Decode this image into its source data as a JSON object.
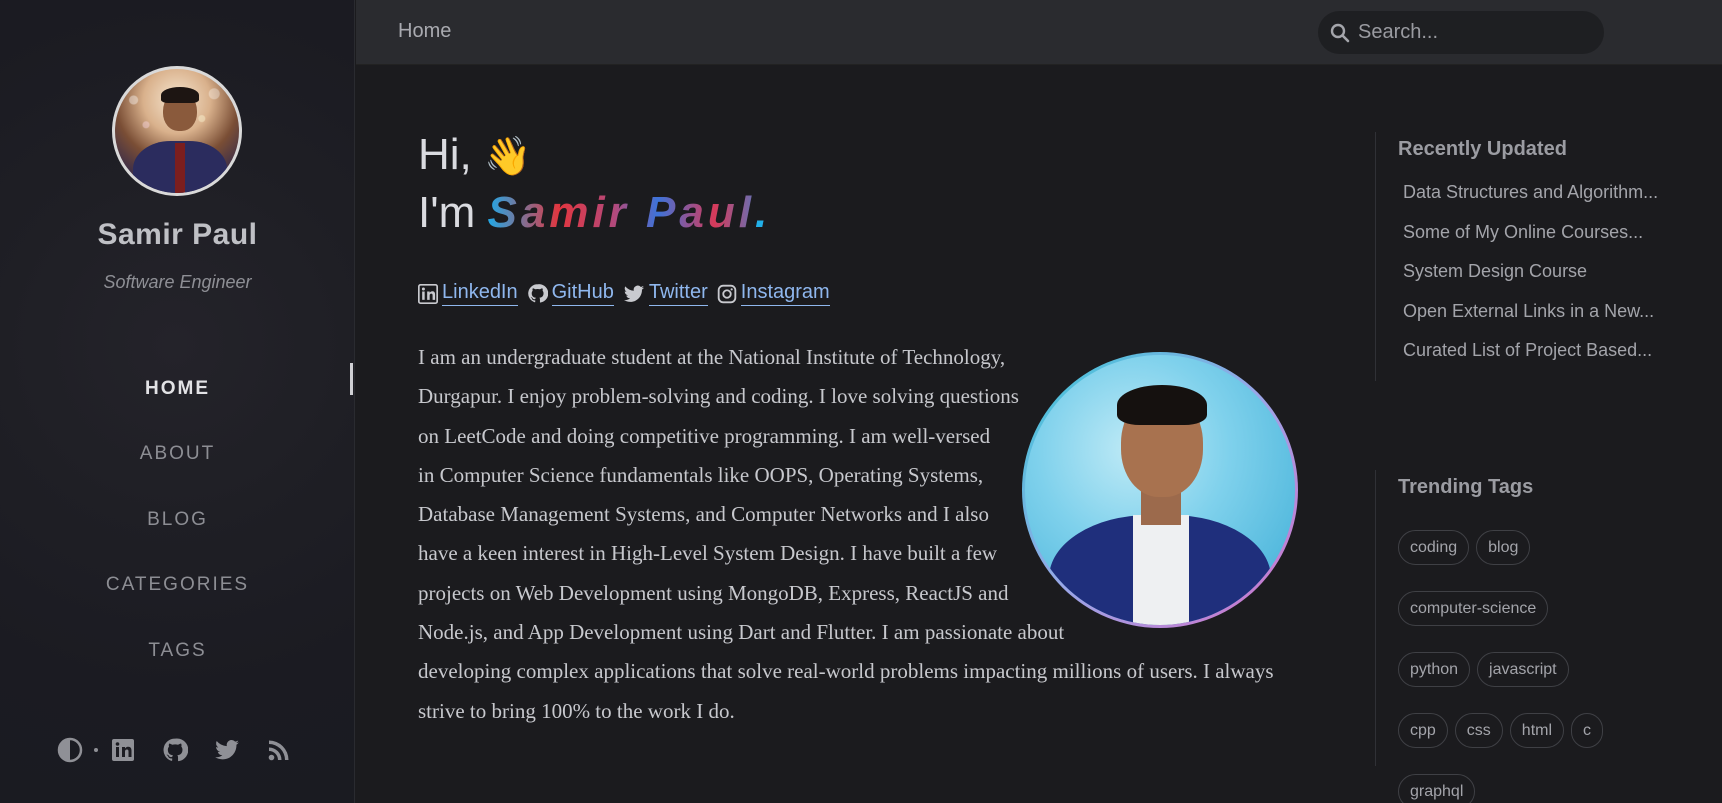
{
  "sidebar": {
    "name": "Samir Paul",
    "role": "Software Engineer",
    "nav": [
      {
        "label": "HOME",
        "active": true
      },
      {
        "label": "ABOUT"
      },
      {
        "label": "BLOG"
      },
      {
        "label": "CATEGORIES"
      },
      {
        "label": "TAGS"
      }
    ],
    "footer_icons": [
      "theme-toggle-icon",
      "linkedin-icon",
      "github-icon",
      "twitter-icon",
      "rss-icon"
    ]
  },
  "topbar": {
    "breadcrumb": "Home",
    "search_placeholder": "Search..."
  },
  "main": {
    "greeting": "Hi,",
    "wave": "👋",
    "im_prefix": "I'm",
    "name_highlight": "Samir Paul",
    "name_dot": ".",
    "links": [
      {
        "label": "LinkedIn",
        "icon": "linkedin-icon"
      },
      {
        "label": "GitHub",
        "icon": "github-icon"
      },
      {
        "label": "Twitter",
        "icon": "twitter-icon"
      },
      {
        "label": "Instagram",
        "icon": "instagram-icon"
      }
    ],
    "bio": "I am an undergraduate student at the National Institute of Technology, Durgapur. I enjoy problem-solving and coding. I love solving questions on LeetCode and doing competitive programming. I am well-versed in Computer Science fundamentals like OOPS, Operating Systems, Database Management Systems, and Computer Networks and I also have a keen interest in High-Level System Design. I have built a few projects on Web Development using MongoDB, Express, ReactJS and Node.js, and App Development using Dart and Flutter. I am passionate about developing complex applications that solve real-world problems impacting millions of users. I always strive to bring 100% to the work I do."
  },
  "panel": {
    "recent_title": "Recently Updated",
    "recent": [
      "Data Structures and Algorithm...",
      "Some of My Online Courses...",
      "System Design Course",
      "Open External Links in a New...",
      "Curated List of Project Based..."
    ],
    "tags_title": "Trending Tags",
    "tags": [
      "coding",
      "blog",
      "computer-science",
      "python",
      "javascript",
      "cpp",
      "css",
      "html",
      "c",
      "graphql"
    ]
  },
  "colors": {
    "background": "#1b1b1e",
    "topbar": "#2a2b2f",
    "link": "#8fb7ee",
    "name_gradient_start": "#22a8e6",
    "name_gradient_mid": "#e2363f"
  }
}
